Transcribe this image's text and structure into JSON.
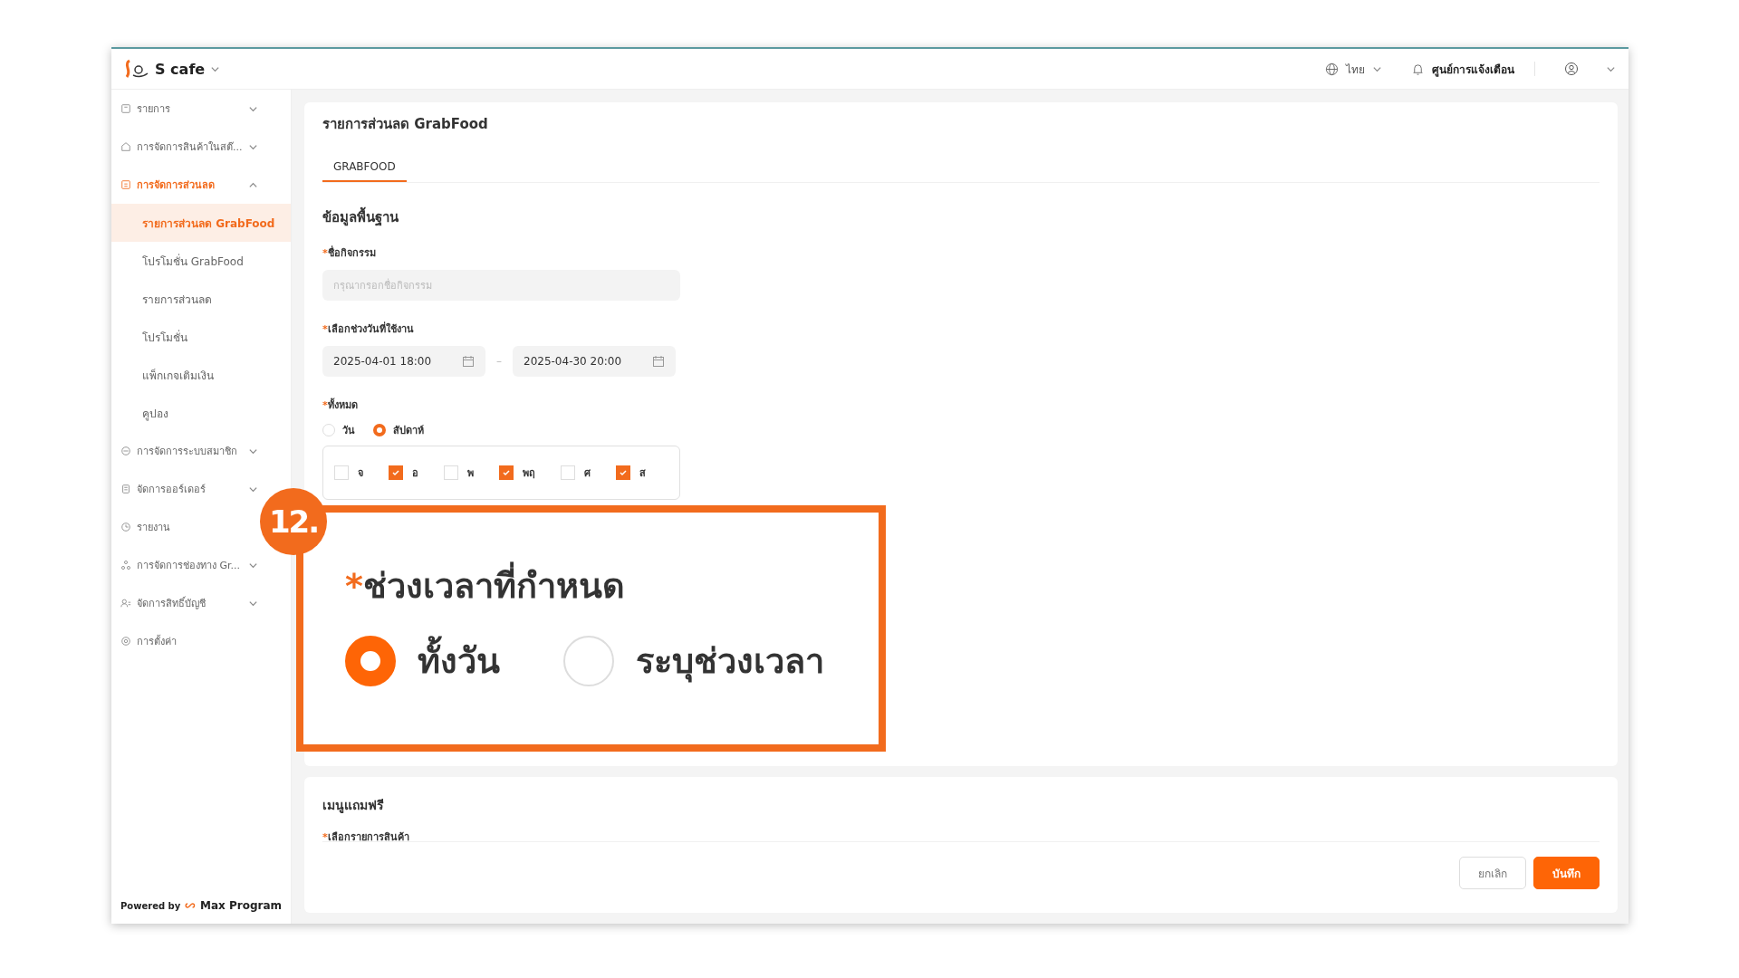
{
  "header": {
    "brand": "S cafe",
    "language": "ไทย",
    "notifications": "ศูนย์การแจ้งเตือน"
  },
  "sidebar": {
    "items": [
      {
        "label": "รายการ",
        "expanded": false,
        "selected": false
      },
      {
        "label": "การจัดการสินค้าในสต๊...",
        "expanded": false,
        "selected": false
      },
      {
        "label": "การจัดการส่วนลด",
        "expanded": true,
        "selected": true,
        "children": [
          {
            "label": "รายการส่วนลด GrabFood",
            "selected": true
          },
          {
            "label": "โปรโมชั่น GrabFood",
            "selected": false
          },
          {
            "label": "รายการส่วนลด",
            "selected": false
          },
          {
            "label": "โปรโมชั่น",
            "selected": false
          },
          {
            "label": "แพ็กเกจเติมเงิน",
            "selected": false
          },
          {
            "label": "คูปอง",
            "selected": false
          }
        ]
      },
      {
        "label": "การจัดการระบบสมาชิก",
        "expanded": false,
        "selected": false
      },
      {
        "label": "จัดการออร์เดอร์",
        "expanded": false,
        "selected": false
      },
      {
        "label": "รายงาน",
        "selected": false
      },
      {
        "label": "การจัดการช่องทาง Gr...",
        "expanded": false,
        "selected": false
      },
      {
        "label": "จัดการสิทธิ์บัญชี",
        "expanded": false,
        "selected": false
      },
      {
        "label": "การตั้งค่า",
        "selected": false
      }
    ],
    "powered_by": "Powered by",
    "partner": "Max Program"
  },
  "page": {
    "title": "รายการส่วนลด GrabFood",
    "tabs": [
      {
        "label": "GRABFOOD",
        "selected": true
      }
    ],
    "section": "ข้อมูลพื้นฐาน",
    "activity_name": {
      "required_mark": "*",
      "label": "ชื่อกิจกรรม",
      "placeholder": "กรุณากรอกชื่อกิจกรรม"
    },
    "date_range": {
      "required_mark": "*",
      "label": "เลือกช่วงวันที่ใช้งาน",
      "start": "2025-04-01 18:00",
      "separator": "–",
      "end": "2025-04-30 20:00"
    },
    "repeat": {
      "required_mark": "*",
      "label": "ทั้งหมด",
      "options": [
        {
          "label": "วัน",
          "selected": false
        },
        {
          "label": "สัปดาห์",
          "selected": true
        }
      ],
      "days": [
        {
          "label": "จ",
          "checked": false
        },
        {
          "label": "อ",
          "checked": true
        },
        {
          "label": "พ",
          "checked": false
        },
        {
          "label": "พฤ",
          "checked": true
        },
        {
          "label": "ศ",
          "checked": false
        },
        {
          "label": "ส",
          "checked": true
        }
      ]
    },
    "section_2": "เมนูแถมฟรี",
    "products": {
      "required_mark": "*",
      "label": "เลือกรายการสินค้า"
    },
    "buttons": [
      {
        "label": "ยกเลิก",
        "kind": "secondary"
      },
      {
        "label": "บันทึก",
        "kind": "primary"
      }
    ]
  },
  "callout": {
    "badge": "12.",
    "required_mark": "*",
    "label": "ช่วงเวลาที่กำหนด",
    "options": [
      {
        "label": "ทั้งวัน",
        "selected": true
      },
      {
        "label": "ระบุช่วงเวลา",
        "selected": false
      }
    ]
  }
}
